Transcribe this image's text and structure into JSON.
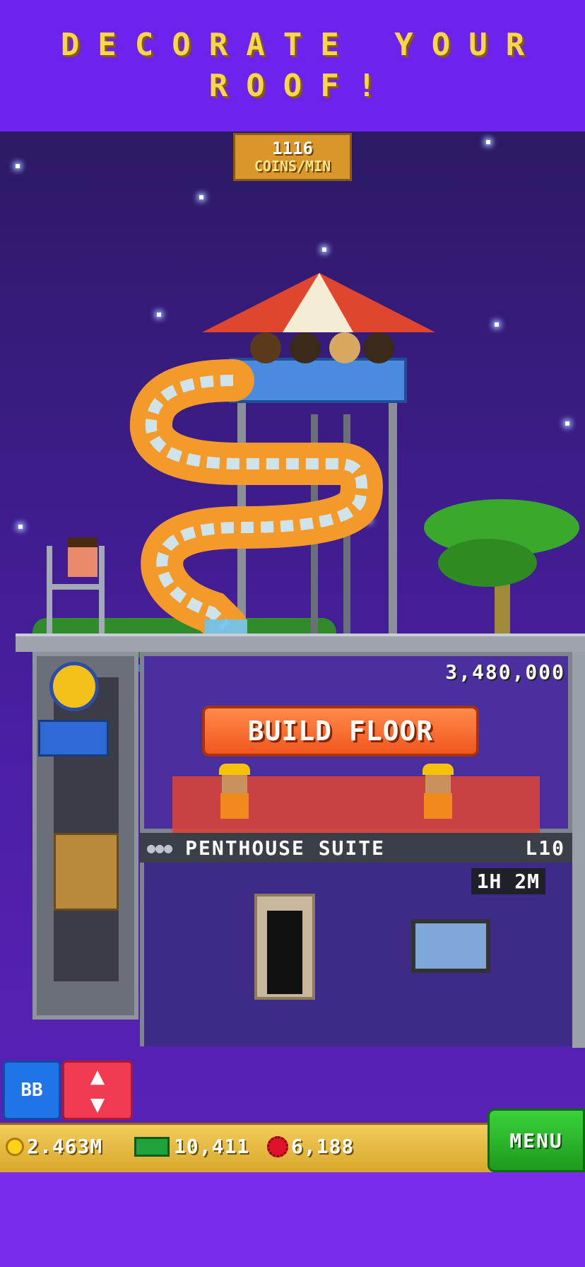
{
  "banner": {
    "line1": "DECORATE YOUR",
    "line2": "ROOF!"
  },
  "income": {
    "value": "1116",
    "label": "COINS/MIN"
  },
  "build_floor": {
    "cost": "3,480,000",
    "button_label": "BUILD FLOOR"
  },
  "floor": {
    "name": "PENTHOUSE SUITE",
    "level": "L10",
    "timer": "1H 2M"
  },
  "controls": {
    "bitbook_label": "BB",
    "elevator_icon": "up-down-arrows-icon"
  },
  "resources": {
    "coins": "2.463M",
    "bux": "10,411",
    "gems": "6,188"
  },
  "menu": {
    "label": "MENU"
  },
  "colors": {
    "banner_text": "#f6d74a",
    "build_button": "#f0561e",
    "menu_button": "#1d9a1d",
    "bb_button": "#1f74e6",
    "lift_button": "#f23a53"
  }
}
